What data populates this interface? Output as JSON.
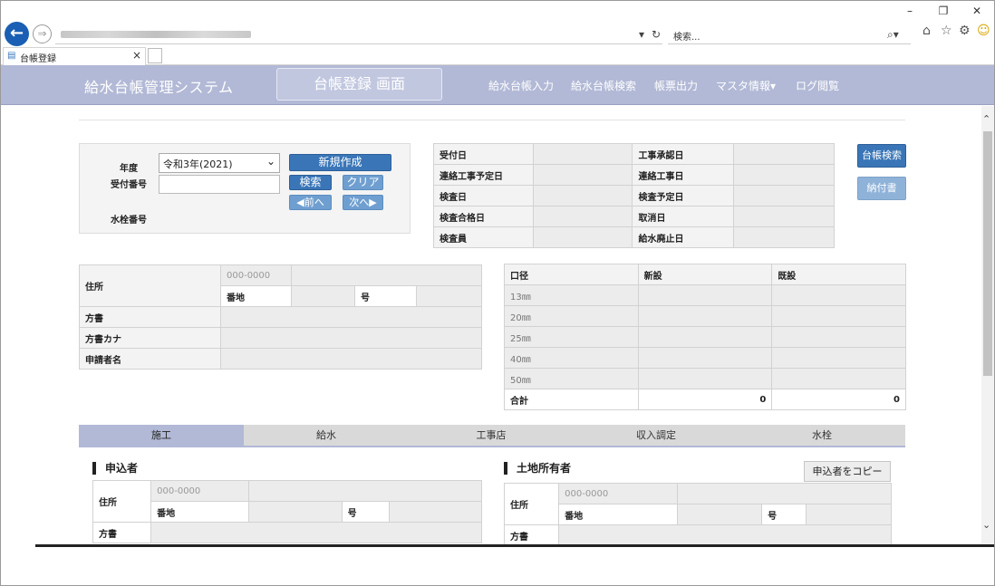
{
  "browser": {
    "search_placeholder": "検索...",
    "tab_title": "台帳登録"
  },
  "app": {
    "system_name": "給水台帳管理システム",
    "screen_title": "台帳登録 画面",
    "nav": [
      "給水台帳入力",
      "給水台帳検索",
      "帳票出力",
      "マスタ情報▾",
      "ログ閲覧"
    ]
  },
  "search_panel": {
    "year_label": "年度",
    "year_value": "令和3年(2021)",
    "receipt_label": "受付番号",
    "meter_label": "水栓番号",
    "new_button": "新規作成",
    "search_button": "検索",
    "clear_button": "クリア",
    "prev_button": "◀前へ",
    "next_button": "次へ▶"
  },
  "dates_table": {
    "left": [
      "受付日",
      "連絡工事予定日",
      "検査日",
      "検査合格日",
      "検査員"
    ],
    "right": [
      "工事承認日",
      "連絡工事日",
      "検査予定日",
      "取消日",
      "給水廃止日"
    ]
  },
  "side_buttons": {
    "ledger_search": "台帳検索",
    "invoice": "納付書"
  },
  "address_table": {
    "address_label": "住所",
    "zip_placeholder": "000-0000",
    "banchi_label": "番地",
    "go_label": "号",
    "katagaki_label": "方書",
    "katagaki_kana_label": "方書カナ",
    "applicant_label": "申請者名"
  },
  "caliber_table": {
    "headers": [
      "口径",
      "新設",
      "既設"
    ],
    "rows": [
      "13㎜",
      "20㎜",
      "25㎜",
      "40㎜",
      "50㎜"
    ],
    "total_label": "合計",
    "total_new": "0",
    "total_existing": "0"
  },
  "tabs": [
    "施工",
    "給水",
    "工事店",
    "収入調定",
    "水栓"
  ],
  "applicant_section": {
    "title": "申込者",
    "address_label": "住所",
    "zip_placeholder": "000-0000",
    "banchi_label": "番地",
    "go_label": "号",
    "katagaki_label": "方書"
  },
  "owner_section": {
    "title": "土地所有者",
    "copy_button": "申込者をコピー",
    "address_label": "住所",
    "zip_placeholder": "000-0000",
    "banchi_label": "番地",
    "go_label": "号",
    "katagaki_label": "方書"
  },
  "colors": {
    "nav_bg": "#b2b9d6",
    "primary_button": "#3a76b7",
    "light_button": "#6f9fd0"
  }
}
